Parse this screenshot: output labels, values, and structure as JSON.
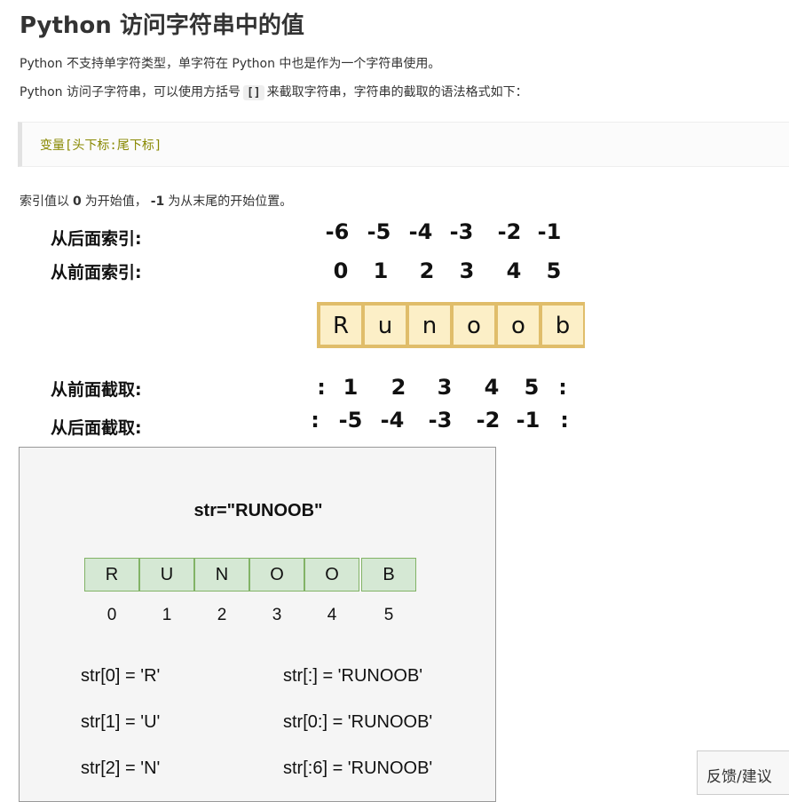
{
  "title": "Python 访问字符串中的值",
  "para1": "Python 不支持单字符类型，单字符在 Python 中也是作为一个字符串使用。",
  "para2_before": "Python 访问子字符串，可以使用方括号",
  "para2_code": "[]",
  "para2_after": "来截取字符串，字符串的截取的语法格式如下：",
  "code_block": "变量[头下标:尾下标]",
  "para3_a": "索引值以",
  "para3_b": "0",
  "para3_c": "为开始值，",
  "para3_d": "-1",
  "para3_e": "为从末尾的开始位置。",
  "figure1": {
    "label_back_index": "从后面索引:",
    "label_front_index": "从前面索引:",
    "back_index": [
      "-6",
      "-5",
      "-4",
      "-3",
      "-2",
      "-1"
    ],
    "front_index": [
      "0",
      "1",
      "2",
      "3",
      "4",
      "5"
    ],
    "letters": [
      "R",
      "u",
      "n",
      "o",
      "o",
      "b"
    ],
    "label_front_slice": "从前面截取:",
    "label_back_slice": "从后面截取:",
    "front_slice": [
      ":",
      "1",
      "2",
      "3",
      "4",
      "5",
      ":"
    ],
    "back_slice": [
      ":",
      "-5",
      "-4",
      "-3",
      "-2",
      "-1",
      ":"
    ]
  },
  "figure2": {
    "title": "str=\"RUNOOB\"",
    "letters": [
      "R",
      "U",
      "N",
      "O",
      "O",
      "B"
    ],
    "indices": [
      "0",
      "1",
      "2",
      "3",
      "4",
      "5"
    ],
    "left_examples": [
      "str[0] = 'R'",
      "str[1] = 'U'",
      "str[2] = 'N'"
    ],
    "right_examples": [
      "str[:] = 'RUNOOB'",
      "str[0:] = 'RUNOOB'",
      "str[:6] = 'RUNOOB'"
    ]
  },
  "feedback_label": "反馈/建议"
}
